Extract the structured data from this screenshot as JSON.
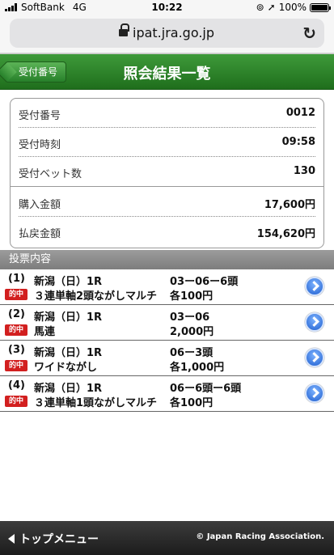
{
  "status_bar": {
    "carrier": "SoftBank",
    "network": "4G",
    "time": "10:22",
    "battery": "100%",
    "battery_level": 1.0
  },
  "browser": {
    "url": "ipat.jra.go.jp"
  },
  "header": {
    "back_label": "受付番号",
    "title": "照会結果一覧"
  },
  "summary": [
    {
      "label": "受付番号",
      "value": "0012"
    },
    {
      "label": "受付時刻",
      "value": "09:58"
    },
    {
      "label": "受付ベット数",
      "value": "130"
    },
    {
      "label": "購入金額",
      "value": "17,600円"
    },
    {
      "label": "払戻金額",
      "value": "154,620円"
    }
  ],
  "section_title": "投票内容",
  "tickets": [
    {
      "num": "(1)",
      "race": "新潟（日）1R",
      "badge": "的中",
      "type": "３連単軸2頭ながしマルチ",
      "combo": "03ー06ー6頭",
      "amount": "各100円"
    },
    {
      "num": "(2)",
      "race": "新潟（日）1R",
      "badge": "的中",
      "type": "馬連",
      "combo": "03ー06",
      "amount": "2,000円"
    },
    {
      "num": "(3)",
      "race": "新潟（日）1R",
      "badge": "的中",
      "type": "ワイドながし",
      "combo": "06ー3頭",
      "amount": "各1,000円"
    },
    {
      "num": "(4)",
      "race": "新潟（日）1R",
      "badge": "的中",
      "type": "３連単軸1頭ながしマルチ",
      "combo": "06ー6頭ー6頭",
      "amount": "各100円"
    }
  ],
  "footer": {
    "top_menu": "トップメニュー",
    "copyright": "© Japan Racing Association."
  },
  "colors": {
    "header_green": "#2f8a2c",
    "badge_red": "#d21f1f",
    "link_blue": "#1f5fd0"
  }
}
